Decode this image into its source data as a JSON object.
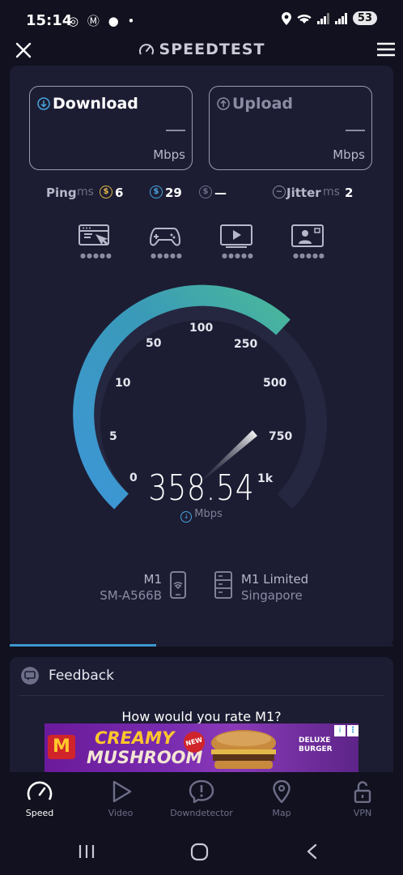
{
  "status": {
    "time": "15:14",
    "left_icons": "◎ Ⓜ ● •",
    "battery": "53"
  },
  "appbar": {
    "title": "SPEEDTEST"
  },
  "results": {
    "download": {
      "label": "Download",
      "value": "—",
      "unit": "Mbps"
    },
    "upload": {
      "label": "Upload",
      "value": "—",
      "unit": "Mbps"
    },
    "ping": {
      "label": "Ping",
      "unit": "ms",
      "idle": "6",
      "download": "29",
      "upload": "—"
    },
    "jitter": {
      "label": "Jitter",
      "unit": "ms",
      "value": "2"
    }
  },
  "gauge": {
    "ticks": [
      "0",
      "5",
      "10",
      "50",
      "100",
      "250",
      "500",
      "750",
      "1k"
    ],
    "speed": "358.54",
    "unit": "Mbps"
  },
  "server": {
    "device_name": "M1",
    "device_model": "SM-A566B",
    "provider": "M1 Limited",
    "location": "Singapore"
  },
  "feedback": {
    "title": "Feedback",
    "question": "How would you rate M1?"
  },
  "ad": {
    "line1": "CREAMY",
    "line2": "MUSHROOM",
    "badge": "NEW",
    "side1": "DELUXE",
    "side2": "BURGER"
  },
  "nav": {
    "items": [
      {
        "label": "Speed",
        "icon": "speedometer-icon"
      },
      {
        "label": "Video",
        "icon": "play-icon"
      },
      {
        "label": "Downdetector",
        "icon": "alert-icon"
      },
      {
        "label": "Map",
        "icon": "map-pin-icon"
      },
      {
        "label": "VPN",
        "icon": "unlock-icon"
      }
    ]
  },
  "colors": {
    "background": "#11111f",
    "card": "#1c1d33",
    "accent": "#3c97cf",
    "gauge_start": "#3d96d6",
    "gauge_end": "#4ab89a"
  }
}
